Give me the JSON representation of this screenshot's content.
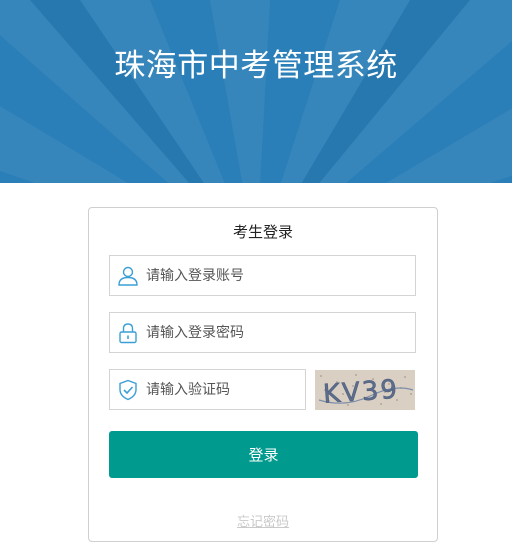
{
  "header": {
    "title": "珠海市中考管理系统"
  },
  "login": {
    "title": "考生登录",
    "account": {
      "placeholder": "请输入登录账号",
      "value": ""
    },
    "password": {
      "placeholder": "请输入登录密码",
      "value": ""
    },
    "captcha": {
      "placeholder": "请输入验证码",
      "value": "",
      "image_text": "KV39"
    },
    "submit_label": "登录",
    "forgot_label": "忘记密码"
  },
  "colors": {
    "banner": "#2a7fb8",
    "button": "#009a8e",
    "icon": "#3a9fd6"
  },
  "icons": [
    "user-icon",
    "lock-icon",
    "shield-icon"
  ]
}
